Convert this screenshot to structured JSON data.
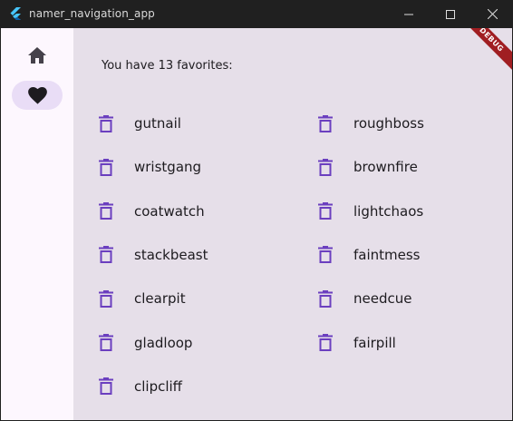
{
  "window": {
    "title": "namer_navigation_app",
    "controls": [
      "minimize",
      "maximize",
      "close"
    ]
  },
  "rail": {
    "items": [
      {
        "name": "home",
        "icon": "home-icon",
        "selected": false
      },
      {
        "name": "favorites",
        "icon": "heart-icon",
        "selected": true
      }
    ]
  },
  "favorites": {
    "summary": "You have 13 favorites:",
    "items": [
      "gutnail",
      "roughboss",
      "wristgang",
      "brownfire",
      "coatwatch",
      "lightchaos",
      "stackbeast",
      "faintmess",
      "clearpit",
      "needcue",
      "gladloop",
      "fairpill",
      "clipcliff"
    ]
  },
  "banner": {
    "text": "DEBUG"
  },
  "colors": {
    "accent": "#6b3fbf",
    "background": "#e6dfe9",
    "rail": "#fdf7fe",
    "selected": "#e9ddf6"
  }
}
